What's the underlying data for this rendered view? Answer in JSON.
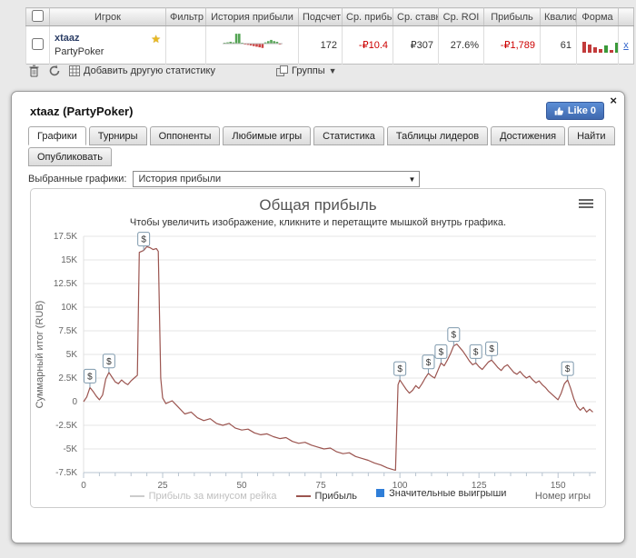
{
  "colors": {
    "negative": "#cc0000",
    "like_button": "#4a79c4",
    "profit_line": "#9b544f",
    "flag_blue": "#2f7ed8"
  },
  "table": {
    "headers": {
      "player": "Игрок",
      "filter": "Фильтр",
      "history": "История прибыли",
      "count": "Подсчет",
      "avg_profit": "Ср. прибыль",
      "avg_stake": "Ср. ставка",
      "avg_roi": "Ср. ROI",
      "profit": "Прибыль",
      "qualified": "Квалиф",
      "form": "Форма"
    },
    "row": {
      "player_name": "xtaaz",
      "site": "PartyPoker",
      "count": "172",
      "avg_profit": "-₽10.4",
      "avg_stake": "₽307",
      "avg_roi": "27.6%",
      "profit": "-₽1,789",
      "qualified": "61",
      "collapse_link": "x",
      "sparkline": [
        1,
        2,
        3,
        2,
        16,
        16,
        1,
        -1,
        -2,
        -3,
        -4,
        -5,
        -6,
        -7,
        2,
        4,
        6,
        4,
        3,
        -1
      ],
      "form_bars": [
        -12,
        -9,
        -6,
        -4,
        8,
        -3,
        11
      ]
    }
  },
  "toolbar": {
    "add_stat": "Добавить другую статистику",
    "groups": "Группы"
  },
  "panel": {
    "title": "xtaaz (PartyPoker)",
    "like_label": "Like 0",
    "close_label": "×",
    "tabs": [
      {
        "label": "Графики"
      },
      {
        "label": "Турниры"
      },
      {
        "label": "Оппоненты"
      },
      {
        "label": "Любимые игры"
      },
      {
        "label": "Статистика"
      },
      {
        "label": "Таблицы лидеров"
      },
      {
        "label": "Достижения"
      },
      {
        "label": "Найти"
      }
    ],
    "tabs2": [
      {
        "label": "Опубликовать"
      }
    ],
    "chart_select_label": "Выбранные графики:",
    "chart_select_value": "История прибыли"
  },
  "chart_data": {
    "type": "line",
    "title": "Общая прибыль",
    "subtitle": "Чтобы увеличить изображение, кликните и перетащите мышкой внутрь графика.",
    "xlabel": "Номер игры",
    "ylabel": "Суммарный итог (RUB)",
    "xlim": [
      0,
      162
    ],
    "ylim": [
      -7500,
      17500
    ],
    "grid": true,
    "legend_position": "bottom",
    "yticks": [
      -7500,
      -5000,
      -2500,
      0,
      2500,
      5000,
      7500,
      10000,
      12500,
      15000,
      17500
    ],
    "ytick_labels": [
      "-7.5K",
      "-5K",
      "-2.5K",
      "0",
      "2.5K",
      "5K",
      "7.5K",
      "10K",
      "12.5K",
      "15K",
      "17.5K"
    ],
    "xticks": [
      0,
      25,
      50,
      75,
      100,
      125,
      150
    ],
    "series": [
      {
        "name": "Прибыль за минусом рейка",
        "color": "#cccccc",
        "visible": false,
        "points": []
      },
      {
        "name": "Прибыль",
        "color": "#9b544f",
        "visible": true,
        "points": [
          [
            0,
            0
          ],
          [
            1,
            500
          ],
          [
            2,
            1500
          ],
          [
            3,
            1100
          ],
          [
            4,
            600
          ],
          [
            5,
            200
          ],
          [
            6,
            700
          ],
          [
            7,
            2400
          ],
          [
            8,
            3100
          ],
          [
            9,
            2600
          ],
          [
            10,
            2100
          ],
          [
            11,
            1900
          ],
          [
            12,
            2300
          ],
          [
            13,
            2000
          ],
          [
            14,
            1800
          ],
          [
            15,
            2200
          ],
          [
            16,
            2500
          ],
          [
            17,
            2800
          ],
          [
            17.6,
            15800
          ],
          [
            19,
            16000
          ],
          [
            20,
            16400
          ],
          [
            21,
            16300
          ],
          [
            22,
            16100
          ],
          [
            23,
            16200
          ],
          [
            23.6,
            15900
          ],
          [
            24.4,
            2500
          ],
          [
            25,
            400
          ],
          [
            26,
            -200
          ],
          [
            28,
            100
          ],
          [
            30,
            -600
          ],
          [
            32,
            -1300
          ],
          [
            34,
            -1100
          ],
          [
            36,
            -1700
          ],
          [
            38,
            -2000
          ],
          [
            40,
            -1800
          ],
          [
            42,
            -2300
          ],
          [
            44,
            -2500
          ],
          [
            46,
            -2300
          ],
          [
            48,
            -2800
          ],
          [
            50,
            -3000
          ],
          [
            52,
            -2900
          ],
          [
            54,
            -3300
          ],
          [
            56,
            -3500
          ],
          [
            58,
            -3400
          ],
          [
            60,
            -3700
          ],
          [
            62,
            -3900
          ],
          [
            64,
            -3800
          ],
          [
            66,
            -4200
          ],
          [
            68,
            -4400
          ],
          [
            70,
            -4300
          ],
          [
            72,
            -4600
          ],
          [
            74,
            -4800
          ],
          [
            76,
            -5000
          ],
          [
            78,
            -4900
          ],
          [
            80,
            -5300
          ],
          [
            82,
            -5500
          ],
          [
            84,
            -5400
          ],
          [
            86,
            -5800
          ],
          [
            88,
            -6000
          ],
          [
            90,
            -6200
          ],
          [
            92,
            -6500
          ],
          [
            94,
            -6700
          ],
          [
            96,
            -7000
          ],
          [
            98,
            -7200
          ],
          [
            98.6,
            -7250
          ],
          [
            99.4,
            1800
          ],
          [
            100,
            2300
          ],
          [
            101,
            1800
          ],
          [
            102,
            1300
          ],
          [
            103,
            900
          ],
          [
            104,
            1200
          ],
          [
            105,
            1700
          ],
          [
            106,
            1400
          ],
          [
            107,
            1900
          ],
          [
            108,
            2500
          ],
          [
            109,
            3000
          ],
          [
            110,
            2700
          ],
          [
            111,
            2500
          ],
          [
            112,
            3300
          ],
          [
            113,
            4100
          ],
          [
            114,
            3800
          ],
          [
            115,
            4400
          ],
          [
            116,
            5100
          ],
          [
            117,
            5900
          ],
          [
            118,
            6100
          ],
          [
            119,
            5700
          ],
          [
            120,
            5300
          ],
          [
            121,
            4800
          ],
          [
            122,
            4300
          ],
          [
            123,
            3900
          ],
          [
            124,
            4100
          ],
          [
            125,
            3700
          ],
          [
            126,
            3400
          ],
          [
            127,
            3800
          ],
          [
            128,
            4200
          ],
          [
            129,
            4400
          ],
          [
            130,
            4000
          ],
          [
            131,
            3600
          ],
          [
            132,
            3300
          ],
          [
            133,
            3700
          ],
          [
            134,
            3900
          ],
          [
            135,
            3500
          ],
          [
            136,
            3100
          ],
          [
            137,
            2900
          ],
          [
            138,
            3200
          ],
          [
            139,
            2800
          ],
          [
            140,
            2500
          ],
          [
            141,
            2700
          ],
          [
            142,
            2300
          ],
          [
            143,
            2000
          ],
          [
            144,
            2200
          ],
          [
            145,
            1800
          ],
          [
            146,
            1500
          ],
          [
            147,
            1100
          ],
          [
            148,
            800
          ],
          [
            149,
            500
          ],
          [
            150,
            200
          ],
          [
            151,
            900
          ],
          [
            152,
            1900
          ],
          [
            153,
            2300
          ],
          [
            154,
            1400
          ],
          [
            155,
            300
          ],
          [
            156,
            -500
          ],
          [
            157,
            -900
          ],
          [
            158,
            -600
          ],
          [
            159,
            -1100
          ],
          [
            160,
            -800
          ],
          [
            161,
            -1100
          ]
        ]
      }
    ],
    "flags": {
      "name": "Значительные выигрыши",
      "symbol": "$",
      "color": "#2f7ed8",
      "border": "#7e99ad",
      "points": [
        [
          2,
          1500
        ],
        [
          8,
          3100
        ],
        [
          19,
          16000
        ],
        [
          100,
          2300
        ],
        [
          109,
          3000
        ],
        [
          113,
          4100
        ],
        [
          117,
          5900
        ],
        [
          124,
          4100
        ],
        [
          129,
          4400
        ],
        [
          153,
          2300
        ]
      ]
    }
  }
}
